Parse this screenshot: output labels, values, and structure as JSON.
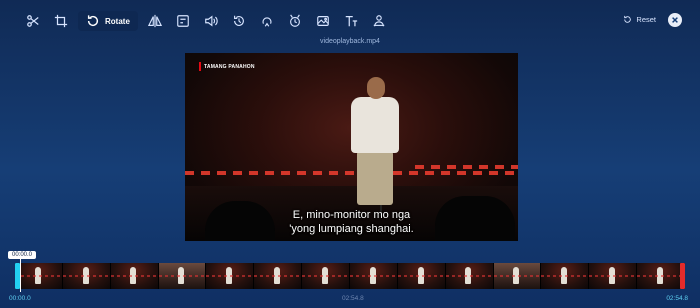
{
  "toolbar": {
    "items": [
      {
        "icon": "scissors-icon"
      },
      {
        "icon": "crop-icon"
      },
      {
        "icon": "rotate-icon",
        "label": "Rotate",
        "active": true
      },
      {
        "icon": "flip-icon"
      },
      {
        "icon": "frame-icon"
      },
      {
        "icon": "volume-icon"
      },
      {
        "icon": "speed-icon"
      },
      {
        "icon": "loop-icon"
      },
      {
        "icon": "filter-icon"
      },
      {
        "icon": "image-icon"
      },
      {
        "icon": "text-icon"
      },
      {
        "icon": "person-icon"
      }
    ],
    "reset_label": "Reset"
  },
  "file_name": "videoplayback.mp4",
  "video": {
    "network_label": "TAMANG PANAHON",
    "subtitle_line1": "E, mino-monitor mo nga",
    "subtitle_line2": "'yong lumpiang shanghai."
  },
  "timeline": {
    "current_time": "00:00.0",
    "start": "00:00.0",
    "middle": "02:54.8",
    "end": "02:54.8"
  },
  "colors": {
    "accent": "#22d0f2",
    "end_marker": "#e32b2b",
    "background": "#163e76"
  }
}
